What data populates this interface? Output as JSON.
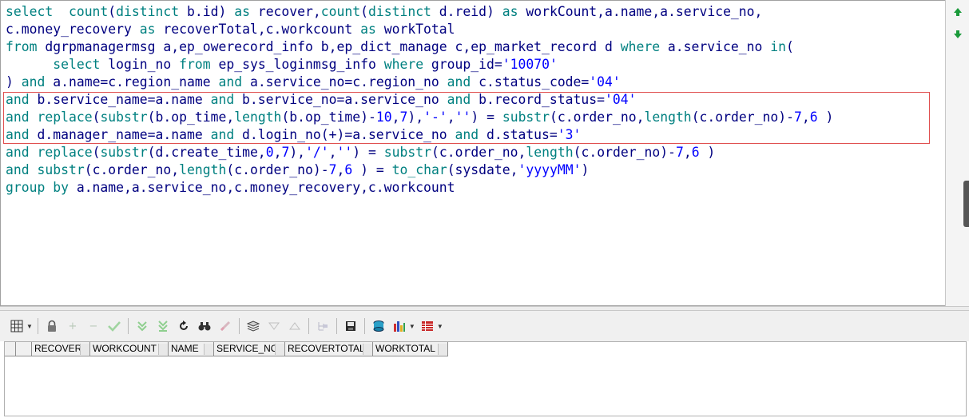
{
  "editor": {
    "lines": [
      [
        [
          "kw",
          "select  "
        ],
        [
          "fn",
          "count"
        ],
        [
          "txt",
          "("
        ],
        [
          "kw",
          "distinct"
        ],
        [
          "txt",
          " b.id) "
        ],
        [
          "kw",
          "as"
        ],
        [
          "txt",
          " recover,"
        ],
        [
          "fn",
          "count"
        ],
        [
          "txt",
          "("
        ],
        [
          "kw",
          "distinct"
        ],
        [
          "txt",
          " d.reid) "
        ],
        [
          "kw",
          "as"
        ],
        [
          "txt",
          " workCount,a.name,a.service_no,"
        ]
      ],
      [
        [
          "txt",
          "c.money_recovery "
        ],
        [
          "kw",
          "as"
        ],
        [
          "txt",
          " recoverTotal,c.workcount "
        ],
        [
          "kw",
          "as"
        ],
        [
          "txt",
          " workTotal"
        ]
      ],
      [
        [
          "kw",
          "from"
        ],
        [
          "txt",
          " dgrpmanagermsg a,ep_owerecord_info b,ep_dict_manage c,ep_market_record d "
        ],
        [
          "kw",
          "where"
        ],
        [
          "txt",
          " a.service_no "
        ],
        [
          "kw",
          "in"
        ],
        [
          "txt",
          "("
        ]
      ],
      [
        [
          "txt",
          "      "
        ],
        [
          "kw",
          "select"
        ],
        [
          "txt",
          " login_no "
        ],
        [
          "kw",
          "from"
        ],
        [
          "txt",
          " ep_sys_loginmsg_info "
        ],
        [
          "kw",
          "where"
        ],
        [
          "txt",
          " group_id="
        ],
        [
          "str",
          "'10070'"
        ]
      ],
      [
        [
          "txt",
          ") "
        ],
        [
          "kw",
          "and"
        ],
        [
          "txt",
          " a.name=c.region_name "
        ],
        [
          "kw",
          "and"
        ],
        [
          "txt",
          " a.service_no=c.region_no "
        ],
        [
          "kw",
          "and"
        ],
        [
          "txt",
          " c.status_code="
        ],
        [
          "str",
          "'04'"
        ]
      ],
      [
        [
          "kw",
          "and"
        ],
        [
          "txt",
          " b.service_name=a.name "
        ],
        [
          "kw",
          "and"
        ],
        [
          "txt",
          " b.service_no=a.service_no "
        ],
        [
          "kw",
          "and"
        ],
        [
          "txt",
          " b.record_status="
        ],
        [
          "str",
          "'04'"
        ]
      ],
      [
        [
          "kw",
          "and"
        ],
        [
          "txt",
          " "
        ],
        [
          "fn",
          "replace"
        ],
        [
          "txt",
          "("
        ],
        [
          "fn",
          "substr"
        ],
        [
          "txt",
          "(b.op_time,"
        ],
        [
          "fn",
          "length"
        ],
        [
          "txt",
          "(b.op_time)-"
        ],
        [
          "num",
          "10"
        ],
        [
          "txt",
          ","
        ],
        [
          "num",
          "7"
        ],
        [
          "txt",
          "),"
        ],
        [
          "str",
          "'-'"
        ],
        [
          "txt",
          ","
        ],
        [
          "str",
          "''"
        ],
        [
          "txt",
          ") = "
        ],
        [
          "fn",
          "substr"
        ],
        [
          "txt",
          "(c.order_no,"
        ],
        [
          "fn",
          "length"
        ],
        [
          "txt",
          "(c.order_no)-"
        ],
        [
          "num",
          "7"
        ],
        [
          "txt",
          ","
        ],
        [
          "num",
          "6"
        ],
        [
          "txt",
          " )"
        ]
      ],
      [
        [
          "kw",
          "and"
        ],
        [
          "txt",
          " d.manager_name=a.name "
        ],
        [
          "kw",
          "and"
        ],
        [
          "txt",
          " d.login_no(+)=a.service_no "
        ],
        [
          "kw",
          "and"
        ],
        [
          "txt",
          " d.status="
        ],
        [
          "str",
          "'3'"
        ]
      ],
      [
        [
          "kw",
          "and"
        ],
        [
          "txt",
          " "
        ],
        [
          "fn",
          "replace"
        ],
        [
          "txt",
          "("
        ],
        [
          "fn",
          "substr"
        ],
        [
          "txt",
          "(d.create_time,"
        ],
        [
          "num",
          "0"
        ],
        [
          "txt",
          ","
        ],
        [
          "num",
          "7"
        ],
        [
          "txt",
          "),"
        ],
        [
          "str",
          "'/'"
        ],
        [
          "txt",
          ","
        ],
        [
          "str",
          "''"
        ],
        [
          "txt",
          ") = "
        ],
        [
          "fn",
          "substr"
        ],
        [
          "txt",
          "(c.order_no,"
        ],
        [
          "fn",
          "length"
        ],
        [
          "txt",
          "(c.order_no)-"
        ],
        [
          "num",
          "7"
        ],
        [
          "txt",
          ","
        ],
        [
          "num",
          "6"
        ],
        [
          "txt",
          " )"
        ]
      ],
      [
        [
          "kw",
          "and"
        ],
        [
          "txt",
          " "
        ],
        [
          "fn",
          "substr"
        ],
        [
          "txt",
          "(c.order_no,"
        ],
        [
          "fn",
          "length"
        ],
        [
          "txt",
          "(c.order_no)-"
        ],
        [
          "num",
          "7"
        ],
        [
          "txt",
          ","
        ],
        [
          "num",
          "6"
        ],
        [
          "txt",
          " ) = "
        ],
        [
          "fn",
          "to_char"
        ],
        [
          "txt",
          "(sysdate,"
        ],
        [
          "str",
          "'yyyyMM'"
        ],
        [
          "txt",
          ")"
        ]
      ],
      [
        [
          "kw",
          "group by"
        ],
        [
          "txt",
          " a.name,a.service_no,c.money_recovery,c.workcount"
        ]
      ]
    ]
  },
  "gutter": {
    "icons": [
      "arrow-up-icon",
      "arrow-down-icon"
    ]
  },
  "toolbar": {
    "buttons": [
      {
        "name": "grid-options-icon",
        "enabled": true,
        "dropdown": true
      },
      {
        "name": "lock-icon",
        "enabled": true
      },
      {
        "name": "add-record-icon",
        "enabled": false
      },
      {
        "name": "delete-record-icon",
        "enabled": false
      },
      {
        "name": "post-changes-icon",
        "enabled": false
      },
      {
        "name": "fetch-next-icon",
        "enabled": false
      },
      {
        "name": "fetch-last-icon",
        "enabled": false
      },
      {
        "name": "refresh-icon",
        "enabled": true
      },
      {
        "name": "find-icon",
        "enabled": true
      },
      {
        "name": "clear-icon",
        "enabled": false
      },
      {
        "name": "query-by-example-icon",
        "enabled": true
      },
      {
        "name": "previous-record-icon",
        "enabled": false
      },
      {
        "name": "next-record-icon",
        "enabled": false
      },
      {
        "name": "tree-view-icon",
        "enabled": false
      },
      {
        "name": "save-icon",
        "enabled": true
      },
      {
        "name": "export-icon",
        "enabled": true
      },
      {
        "name": "chart-icon",
        "enabled": true,
        "dropdown": true
      },
      {
        "name": "single-record-view-icon",
        "enabled": true,
        "dropdown": true
      }
    ]
  },
  "grid": {
    "columns": [
      "RECOVER",
      "WORKCOUNT",
      "NAME",
      "SERVICE_NO",
      "RECOVERTOTAL",
      "WORKTOTAL"
    ]
  },
  "colors": {
    "keyword": "#008080",
    "string": "#0000ff",
    "text": "#000080",
    "highlight_border": "#e05050"
  }
}
